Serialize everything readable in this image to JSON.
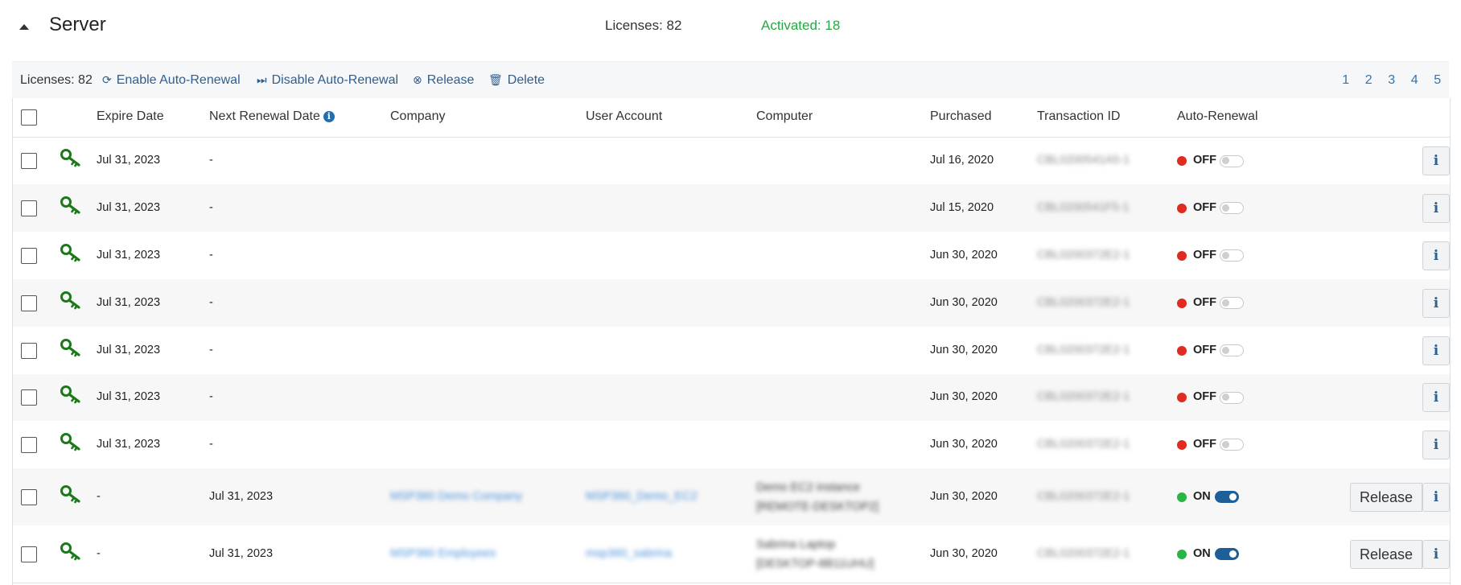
{
  "section": {
    "title": "Server",
    "licenses_label": "Licenses: 82",
    "activated_label": "Activated: 18"
  },
  "toolbar": {
    "licenses_label": "Licenses:",
    "licenses_count": "82",
    "enable_label": "Enable Auto-Renewal",
    "disable_label": "Disable Auto-Renewal",
    "release_label": "Release",
    "delete_label": "Delete",
    "pages": [
      "1",
      "2",
      "3",
      "4",
      "5"
    ]
  },
  "columns": {
    "expire": "Expire Date",
    "next_renewal": "Next Renewal Date",
    "company": "Company",
    "user_account": "User Account",
    "computer": "Computer",
    "purchased": "Purchased",
    "transaction": "Transaction ID",
    "auto_renewal": "Auto-Renewal"
  },
  "colors": {
    "accent": "#2f5f8f",
    "on": "#28b544",
    "off": "#e02b20",
    "activated": "#28a745",
    "key": "#1a7a1a"
  },
  "icons": {
    "key": "key-icon",
    "refresh": "refresh-icon",
    "skip": "skip-icon",
    "release": "x-circle-icon",
    "delete": "trash-icon",
    "info": "info-icon",
    "collapse": "caret-up-icon"
  },
  "release_button_label": "Release",
  "rows": [
    {
      "expire": "Jul 31, 2023",
      "next_renewal": "-",
      "company": "",
      "user_account": "",
      "computer_line1": "",
      "computer_line2": "",
      "purchased": "Jul 16, 2020",
      "transaction": "CBL0200541A5-1",
      "status": "OFF",
      "on": false
    },
    {
      "expire": "Jul 31, 2023",
      "next_renewal": "-",
      "company": "",
      "user_account": "",
      "computer_line1": "",
      "computer_line2": "",
      "purchased": "Jul 15, 2020",
      "transaction": "CBL0200541F5-1",
      "status": "OFF",
      "on": false
    },
    {
      "expire": "Jul 31, 2023",
      "next_renewal": "-",
      "company": "",
      "user_account": "",
      "computer_line1": "",
      "computer_line2": "",
      "purchased": "Jun 30, 2020",
      "transaction": "CBL0200372E2-1",
      "status": "OFF",
      "on": false
    },
    {
      "expire": "Jul 31, 2023",
      "next_renewal": "-",
      "company": "",
      "user_account": "",
      "computer_line1": "",
      "computer_line2": "",
      "purchased": "Jun 30, 2020",
      "transaction": "CBL0200372E2-1",
      "status": "OFF",
      "on": false
    },
    {
      "expire": "Jul 31, 2023",
      "next_renewal": "-",
      "company": "",
      "user_account": "",
      "computer_line1": "",
      "computer_line2": "",
      "purchased": "Jun 30, 2020",
      "transaction": "CBL0200372E2-1",
      "status": "OFF",
      "on": false
    },
    {
      "expire": "Jul 31, 2023",
      "next_renewal": "-",
      "company": "",
      "user_account": "",
      "computer_line1": "",
      "computer_line2": "",
      "purchased": "Jun 30, 2020",
      "transaction": "CBL0200372E2-1",
      "status": "OFF",
      "on": false
    },
    {
      "expire": "Jul 31, 2023",
      "next_renewal": "-",
      "company": "",
      "user_account": "",
      "computer_line1": "",
      "computer_line2": "",
      "purchased": "Jun 30, 2020",
      "transaction": "CBL0200372E2-1",
      "status": "OFF",
      "on": false
    },
    {
      "expire": "-",
      "next_renewal": "Jul 31, 2023",
      "company": "MSP360 Demo Company",
      "user_account": "MSP360_Demo_EC2",
      "computer_line1": "Demo EC2 instance",
      "computer_line2": "[REMOTE-DESKTOP2]",
      "purchased": "Jun 30, 2020",
      "transaction": "CBL0200372E2-1",
      "status": "ON",
      "on": true
    },
    {
      "expire": "-",
      "next_renewal": "Jul 31, 2023",
      "company": "MSP360 Employees",
      "user_account": "msp360_sabrina",
      "computer_line1": "Sabrina Laptop",
      "computer_line2": "[DESKTOP-8B11UHU]",
      "purchased": "Jun 30, 2020",
      "transaction": "CBL0200372E2-1",
      "status": "ON",
      "on": true
    }
  ]
}
